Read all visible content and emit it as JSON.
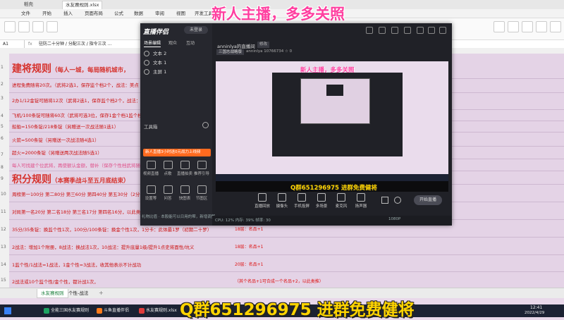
{
  "browser": {
    "tabs": [
      {
        "label": "稻壳",
        "active": false
      },
      {
        "label": "水友赛规则.xlsx",
        "active": false
      }
    ]
  },
  "spreadsheet": {
    "menu": [
      "文件",
      "开始",
      "插入",
      "页面布局",
      "公式",
      "数据",
      "审阅",
      "视图",
      "开发工具"
    ],
    "cell_ref": "A1",
    "formula_text": "驻防二十分钟 / 分配三次 / 指令三次 …",
    "rows": [
      "1",
      "2",
      "3",
      "4",
      "5",
      "6",
      "7",
      "8",
      "9",
      "10",
      "11",
      "12",
      "13",
      "14",
      "15"
    ],
    "heading1": "建将规则",
    "heading1_note": "（每人一城，每局随机城市，",
    "r2": "进程免费随将20次。（武将2选1，保存监个档2个，战法：美点",
    "r3": "2办1/12金锭可随将12次（武将2选1，保存监个档2个，战法：美点",
    "r4": "飞机/100条锭可随将60次（武将可选3位，保存1金个档1监个档，战",
    "r5": "船舶=150条锭/218条锭（另赠送一次战法随1选1）",
    "r6": "火箭=500条锭（另赠送一次战法随4选1）",
    "r7": "超火=2000条锭（另赠送两次战法随5选1）",
    "r8": "每人可找建个位武将，再使额认金额，替补（保存个性档武将随照",
    "heading2": "积分规则",
    "heading2_note": "（本赛季战斗至五月底结束）",
    "r10": "周榜第一100分 第二80分 第三60分 第四40分 第五30分（2分卡以上",
    "r11": "对局第一名20分 第二名18分 第三名17分 第四名16分，以此类推。",
    "r12": "35分/35条锭：换监个性1次，100分/100条锭：换金个性1次，1分卡：此体最1罗（初期二十罗）",
    "r12b": "18层：名品+1",
    "r13": "2战法：增加1个附册，8战法：换战法1次，10战法：提升底量1级/提升1点史将面性/坑义",
    "r13b": "18层：名品+1",
    "r14": "1监个性/1战法=1战法，1金个性=3战法，收其他表示不计战功",
    "r14b": "20层：名品+1",
    "r15": "2战法或10个监个性/金个性，都计战1次，",
    "r15b": "（其个名品+1可合成一个名品+2，以此类推）",
    "sheet_tabs": [
      "水友赛规则",
      "个性-战法"
    ]
  },
  "taskbar": {
    "items": [
      "全能三国水友赛规则",
      "斗鱼直播伴侣",
      "水友赛规则.xlsx"
    ],
    "clock_time": "12:41",
    "clock_date": "2022/4/29"
  },
  "overlay": {
    "top_banner": "新人主播，多多关照",
    "bottom_banner": "Q群651296975 进群免费健将"
  },
  "stream_app": {
    "logo": "直播伴侣",
    "avatar_label": "未登录",
    "subtabs": [
      "场景编辑",
      "观众",
      "互动"
    ],
    "scenes": [
      "文本 2",
      "文本 1",
      "主屏 1"
    ],
    "tools_label": "工具箱",
    "notice": "新人直播3小时送0元战力上线频",
    "tools": [
      "视频直播",
      "点歌",
      "直播拍卖",
      "推荐引导",
      "设置等",
      "问答",
      "快图表",
      "节图区"
    ],
    "status_line": "礼物比值 · 本股能可以日用的帮，新增调整",
    "room_name": "anninlya的直播间",
    "room_tag": "修改",
    "room_type": "三国志战略版",
    "room_meta": "anninlya    10766734    ☆ 0",
    "nested_banner": "新人主播，多多关照",
    "nested_qq": "Q群651296975 进群免费健将",
    "controls": [
      "直播回放",
      "摄像头",
      "手机投屏",
      "多场景",
      "麦克风",
      "扬声器"
    ],
    "start_live": "开始直播",
    "net_status": "CPU: 12%   内存: 39%   帧率: 30",
    "resolution_status": "1080P"
  },
  "colors": {
    "sheet_bg": "#e4d3e6",
    "rule_red": "#d6322d",
    "banner_pink": "#ff3fa0",
    "banner_yellow": "#ffd400",
    "notice_orange": "#ff6a1f",
    "app_bg": "#202127"
  }
}
